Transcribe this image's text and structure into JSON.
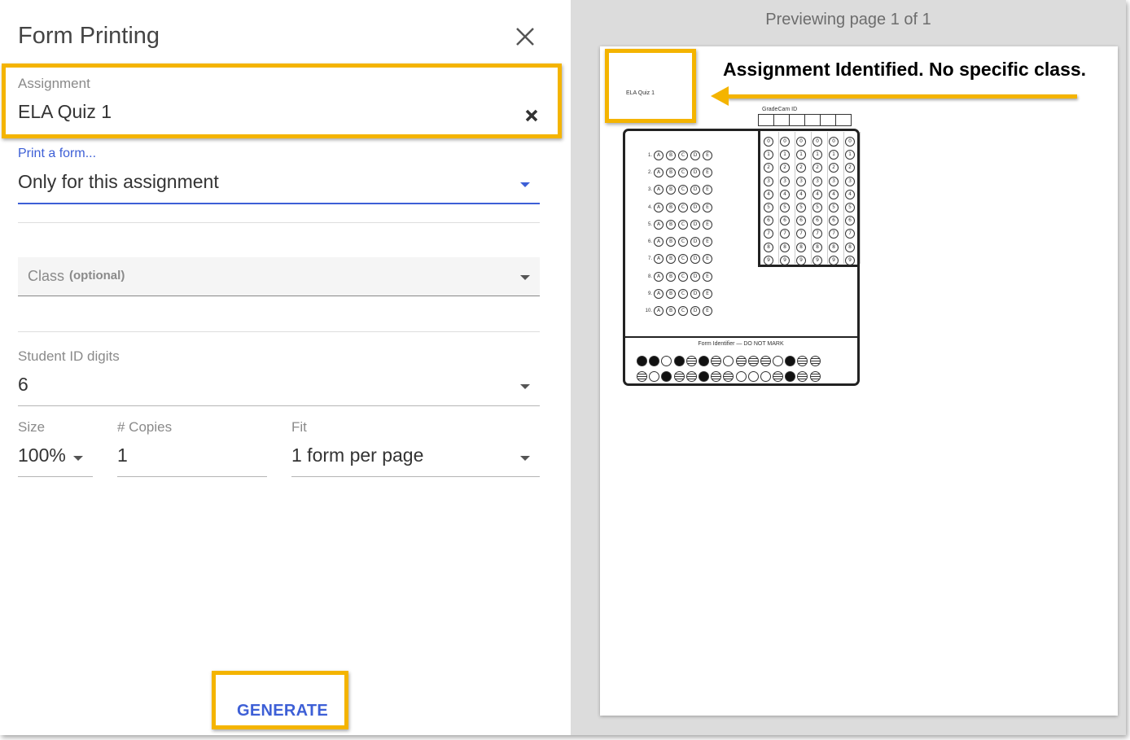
{
  "dialog": {
    "title": "Form Printing",
    "close_icon": "close-icon"
  },
  "assignment": {
    "label": "Assignment",
    "value": "ELA Quiz 1",
    "clear_icon": "clear-icon"
  },
  "print_form": {
    "label": "Print a form...",
    "value": "Only for this assignment"
  },
  "class_field": {
    "label": "Class",
    "hint": "(optional)"
  },
  "student_id": {
    "label": "Student ID digits",
    "value": "6"
  },
  "size": {
    "label": "Size",
    "value": "100%"
  },
  "copies": {
    "label": "# Copies",
    "value": "1"
  },
  "fit": {
    "label": "Fit",
    "value": "1 form per page"
  },
  "generate_label": "GENERATE",
  "preview": {
    "header": "Previewing page 1 of 1",
    "form_title": "ELA Quiz 1",
    "gradecam_label": "GradeCam ID",
    "form_identifier_label": "Form Identifier — DO NOT MARK",
    "question_numbers": [
      "1.",
      "2.",
      "3.",
      "4.",
      "5.",
      "6.",
      "7.",
      "8.",
      "9.",
      "10."
    ],
    "choices": [
      "A",
      "B",
      "C",
      "D",
      "E"
    ],
    "digits": [
      "0",
      "1",
      "2",
      "3",
      "4",
      "5",
      "6",
      "7",
      "8",
      "9"
    ],
    "id_columns": 6,
    "identifier_rows": [
      [
        "filled",
        "filled",
        "empty",
        "filled",
        "striped",
        "filled",
        "striped",
        "empty",
        "striped",
        "striped",
        "striped",
        "empty",
        "filled",
        "striped",
        "striped"
      ],
      [
        "striped",
        "empty",
        "filled",
        "striped",
        "striped",
        "filled",
        "striped",
        "striped",
        "empty",
        "empty",
        "empty",
        "striped",
        "filled",
        "striped",
        "striped"
      ]
    ]
  },
  "annotation": {
    "text": "Assignment Identified. No specific class."
  },
  "colors": {
    "highlight": "#f4b400",
    "accent": "#3d5fd6",
    "preview_bg": "#dcdcdc"
  }
}
